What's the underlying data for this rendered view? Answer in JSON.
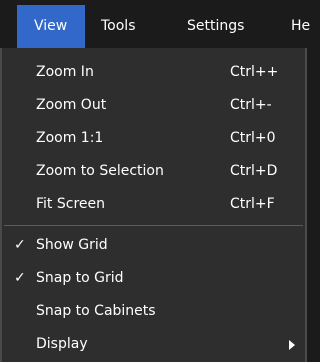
{
  "menubar": {
    "items": [
      {
        "label": "View",
        "active": true
      },
      {
        "label": "Tools",
        "active": false
      },
      {
        "label": "Settings",
        "active": false
      },
      {
        "label": "He",
        "active": false
      }
    ]
  },
  "view_menu": {
    "items": [
      {
        "label": "Zoom In",
        "shortcut": "Ctrl++",
        "checked": false
      },
      {
        "label": "Zoom Out",
        "shortcut": "Ctrl+-",
        "checked": false
      },
      {
        "label": "Zoom 1:1",
        "shortcut": "Ctrl+0",
        "checked": false
      },
      {
        "label": "Zoom to Selection",
        "shortcut": "Ctrl+D",
        "checked": false
      },
      {
        "label": "Fit Screen",
        "shortcut": "Ctrl+F",
        "checked": false
      },
      {
        "label": "Show Grid",
        "shortcut": "",
        "checked": true,
        "check_glyph": "✓"
      },
      {
        "label": "Snap to Grid",
        "shortcut": "",
        "checked": true,
        "check_glyph": "✓"
      },
      {
        "label": "Snap to Cabinets",
        "shortcut": "",
        "checked": false
      },
      {
        "label": "Display",
        "shortcut": "",
        "checked": false,
        "submenu": true
      }
    ]
  },
  "colors": {
    "menubar_bg": "#1b1b1b",
    "active_tab": "#3268c9",
    "menu_bg": "#2e2e2e",
    "separator": "#5a5a5a",
    "text": "#ffffff"
  },
  "icons": {
    "check": "check-icon",
    "submenu": "chevron-right-icon"
  }
}
